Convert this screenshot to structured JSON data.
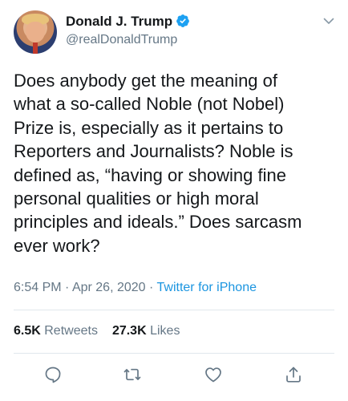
{
  "user": {
    "display_name": "Donald J. Trump",
    "handle": "@realDonaldTrump",
    "verified": true
  },
  "tweet": {
    "text": "Does anybody get the meaning of\nwhat a so-called Noble (not Nobel)\nPrize is, especially as it pertains to\nReporters and Journalists? Noble is\ndefined as, “having or showing fine\npersonal qualities or high moral\nprinciples and ideals.” Does sarcasm\never work?",
    "time": "6:54 PM",
    "separator_1": " · ",
    "date": "Apr 26, 2020",
    "separator_2": " · ",
    "source": "Twitter for iPhone"
  },
  "stats": {
    "retweets_count": "6.5K",
    "retweets_label": " Retweets",
    "likes_count": "27.3K",
    "likes_label": " Likes"
  },
  "icons": {
    "verified": "verified-badge-icon",
    "menu": "chevron-down-icon",
    "reply": "reply-icon",
    "retweet": "retweet-icon",
    "like": "heart-icon",
    "share": "share-icon"
  },
  "colors": {
    "text": "#14171a",
    "secondary": "#657786",
    "link": "#1b95e0",
    "verified": "#1da1f2",
    "divider": "#e1e8ed"
  }
}
